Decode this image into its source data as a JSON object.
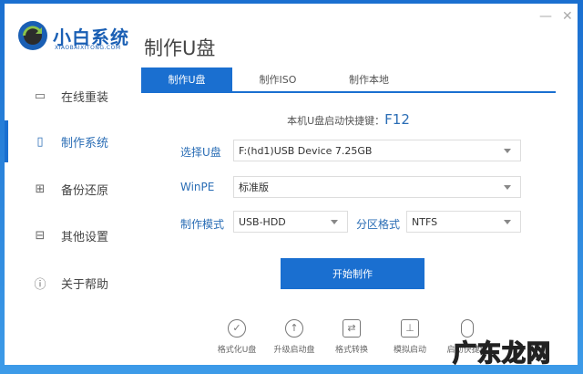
{
  "app": {
    "logo_text": "小白系统",
    "logo_sub": "XIAOBAIXITONG.COM",
    "title": "制作U盘"
  },
  "window": {
    "minimize": "—",
    "close": "✕"
  },
  "sidebar": {
    "items": [
      {
        "label": "在线重装",
        "icon": "monitor-icon"
      },
      {
        "label": "制作系统",
        "icon": "usb-icon",
        "active": true
      },
      {
        "label": "备份还原",
        "icon": "backup-icon"
      },
      {
        "label": "其他设置",
        "icon": "briefcase-icon"
      },
      {
        "label": "关于帮助",
        "icon": "info-icon"
      }
    ]
  },
  "tabs": [
    {
      "label": "制作U盘",
      "active": true
    },
    {
      "label": "制作ISO"
    },
    {
      "label": "制作本地"
    }
  ],
  "hotkey": {
    "label": "本机U盘启动快捷键：",
    "value": "F12"
  },
  "form": {
    "usb_label": "选择U盘",
    "usb_value": "F:(hd1)USB Device 7.25GB",
    "winpe_label": "WinPE",
    "winpe_value": "标准版",
    "mode_label": "制作模式",
    "mode_value": "USB-HDD",
    "fs_label": "分区格式",
    "fs_value": "NTFS"
  },
  "start_button": "开始制作",
  "tools": [
    {
      "label": "格式化U盘",
      "icon": "check-circle-icon"
    },
    {
      "label": "升级启动盘",
      "icon": "upload-circle-icon"
    },
    {
      "label": "格式转换",
      "icon": "convert-icon"
    },
    {
      "label": "模拟启动",
      "icon": "stamp-icon"
    },
    {
      "label": "启动快捷键",
      "icon": "mouse-icon"
    }
  ],
  "watermark": "广东龙网",
  "colors": {
    "accent": "#1a6fd0",
    "label": "#2a6db5"
  }
}
